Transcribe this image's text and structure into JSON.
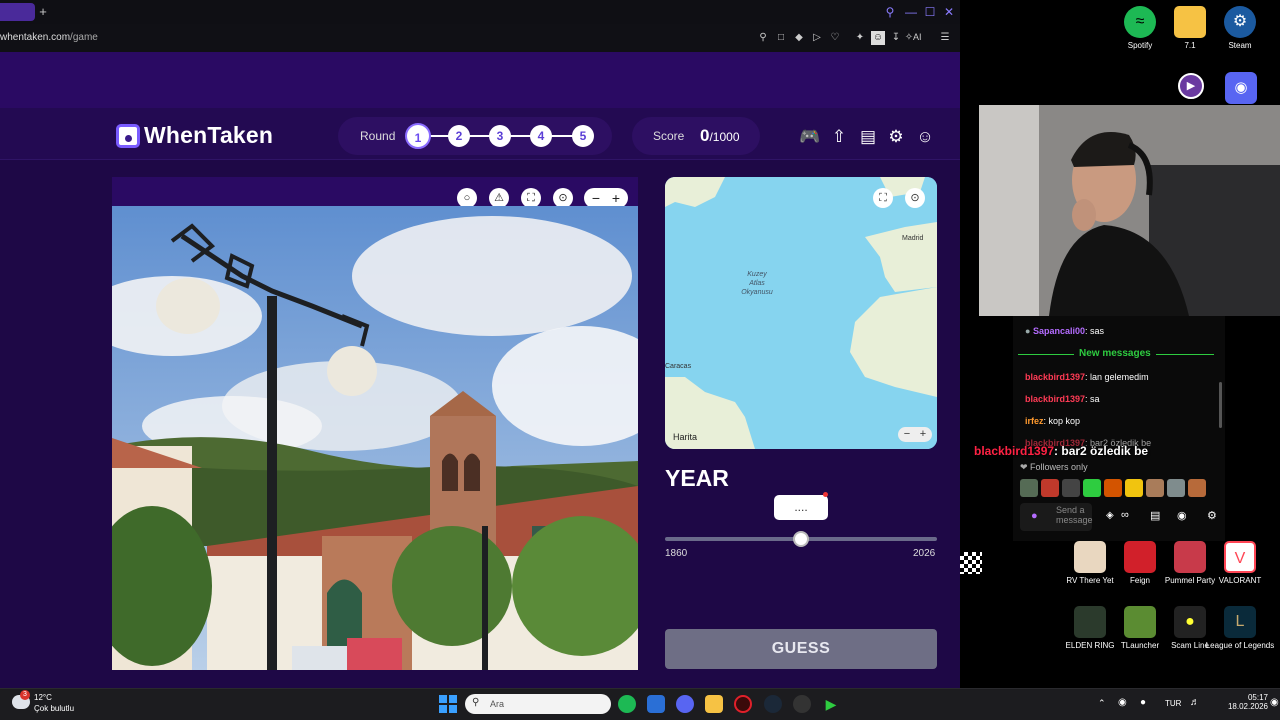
{
  "browser": {
    "url_domain": "whentaken.com",
    "url_path": "/game",
    "new_tab": "+",
    "ai_label": "AI"
  },
  "header": {
    "brand": "WhenTaken",
    "round_label": "Round",
    "rounds": [
      "1",
      "2",
      "3",
      "4",
      "5"
    ],
    "active_round": "1",
    "score_label": "Score",
    "score_value": "0",
    "score_max": "/1000"
  },
  "map": {
    "ocean_label_1": "Kuzey",
    "ocean_label_2": "Atlas",
    "ocean_label_3": "Okyanusu",
    "city_madrid": "Madrid",
    "city_caracas": "Caracas",
    "attribution": "Harita"
  },
  "year_panel": {
    "title": "YEAR",
    "placeholder": "....",
    "min": "1860",
    "max": "2026",
    "thumb_fraction": 0.5,
    "guess_label": "GUESS"
  },
  "desktop": {
    "icons_top": [
      {
        "label": "Spotify"
      },
      {
        "label": "7.1"
      },
      {
        "label": "Steam"
      }
    ],
    "icons_bottom": [
      {
        "label": "RV There Yet"
      },
      {
        "label": "Feign"
      },
      {
        "label": "Pummel Party"
      },
      {
        "label": "VALORANT"
      },
      {
        "label": "ELDEN RING"
      },
      {
        "label": "TLauncher"
      },
      {
        "label": "Scam Line"
      },
      {
        "label": "League of Legends"
      }
    ]
  },
  "chat": {
    "first_user": "Sapancali00",
    "first_msg": ": sas",
    "new_messages": "New messages",
    "lines": [
      {
        "user": "blackbird1397",
        "msg": ": lan gelemedim"
      },
      {
        "user": "blackbird1397",
        "msg": ": sa"
      },
      {
        "user": "irfez",
        "msg": ": kop kop"
      },
      {
        "user": "blackbird1397",
        "msg": ": bar2 özledik be"
      }
    ],
    "overlay_user": "blackbird1397",
    "overlay_msg": ": bar2 özledik be",
    "followers_only": "Followers only",
    "send_placeholder": "Send a message"
  },
  "taskbar": {
    "temp": "12°C",
    "weather": "Çok bulutlu",
    "weather_badge": "3",
    "search_placeholder": "Ara",
    "lang": "TUR",
    "time": "05:17",
    "date": "18.02.2026"
  },
  "colors": {
    "page_bg": "#1e0846",
    "header_bg": "#230a52",
    "accent": "#7a5cff",
    "guess_btn": "#6e6e85",
    "map_water": "#86d4ef",
    "map_land": "#e8efd8"
  }
}
